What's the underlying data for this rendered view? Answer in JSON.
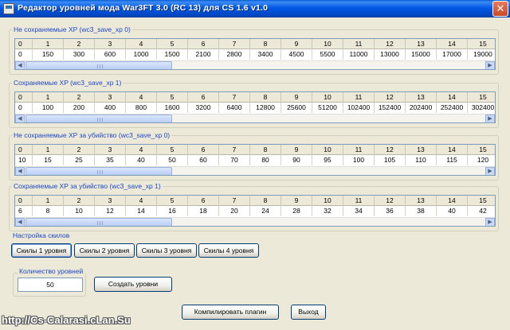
{
  "window": {
    "title": "Редактор уровней мода War3FT 3.0 (RC 13)  для CS 1.6 v1.0",
    "close_glyph": "✕"
  },
  "grids": [
    {
      "label": "Не сохраняемые XP (wc3_save_xp 0)",
      "headers": [
        "0",
        "1",
        "2",
        "3",
        "4",
        "5",
        "6",
        "7",
        "8",
        "9",
        "10",
        "11",
        "12",
        "13",
        "14",
        "15"
      ],
      "values": [
        "0",
        "150",
        "300",
        "600",
        "1000",
        "1500",
        "2100",
        "2800",
        "3400",
        "4500",
        "5500",
        "11000",
        "13000",
        "15000",
        "17000",
        "19000"
      ],
      "scroll_thumb_fraction": 0.32
    },
    {
      "label": "Сохраняемые XP (wc3_save_xp 1)",
      "headers": [
        "0",
        "1",
        "2",
        "3",
        "4",
        "5",
        "6",
        "7",
        "8",
        "9",
        "10",
        "11",
        "12",
        "13",
        "14",
        "15"
      ],
      "values": [
        "0",
        "100",
        "200",
        "400",
        "800",
        "1600",
        "3200",
        "6400",
        "12800",
        "25600",
        "51200",
        "102400",
        "152400",
        "202400",
        "252400",
        "302400"
      ],
      "scroll_thumb_fraction": 0.32
    },
    {
      "label": "Не сохраняемые XP за убийство (wc3_save_xp 0)",
      "headers": [
        "0",
        "1",
        "2",
        "3",
        "4",
        "5",
        "6",
        "7",
        "8",
        "9",
        "10",
        "11",
        "12",
        "13",
        "14",
        "15"
      ],
      "values": [
        "10",
        "15",
        "25",
        "35",
        "40",
        "50",
        "60",
        "70",
        "80",
        "90",
        "95",
        "100",
        "105",
        "110",
        "115",
        "120"
      ],
      "scroll_thumb_fraction": 0.32
    },
    {
      "label": "Сохраняемые XP за убийство (wc3_save_xp 1)",
      "headers": [
        "0",
        "1",
        "2",
        "3",
        "4",
        "5",
        "6",
        "7",
        "8",
        "9",
        "10",
        "11",
        "12",
        "13",
        "14",
        "15"
      ],
      "values": [
        "6",
        "8",
        "10",
        "12",
        "14",
        "16",
        "18",
        "20",
        "24",
        "28",
        "32",
        "34",
        "36",
        "38",
        "40",
        "42"
      ],
      "scroll_thumb_fraction": 0.32
    }
  ],
  "skills": {
    "label": "Настройка скилов",
    "buttons": [
      "Скилы 1 уровня",
      "Скилы 2 уровня",
      "Скилы 3 уровня",
      "Скилы 4 уровня"
    ]
  },
  "levels": {
    "label": "Количество уровней",
    "value": "50",
    "create_button": "Создать уровни"
  },
  "actions": {
    "compile_button": "Компилировать плагин",
    "exit_button": "Выход"
  },
  "watermark": "http://Cs-Calarasi.cLan.Su"
}
